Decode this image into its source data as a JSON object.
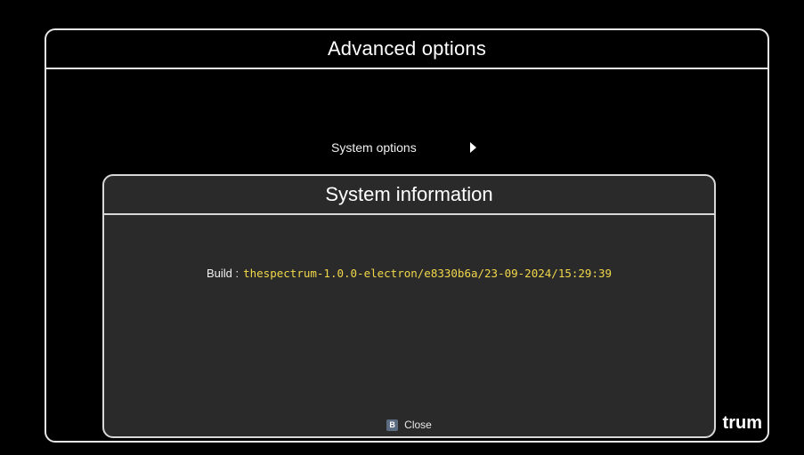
{
  "advanced_options": {
    "title": "Advanced options",
    "menu": {
      "system_options_label": "System options",
      "arrow_icon": "triangle-right-icon"
    },
    "brand_partial": "trum"
  },
  "system_information": {
    "title": "System information",
    "build_label": "Build :",
    "build_value": "thespectrum-1.0.0-electron/e8330b6a/23-09-2024/15:29:39",
    "footer": {
      "button_key": "B",
      "close_label": "Close"
    }
  },
  "colors": {
    "background": "#000000",
    "panel": "#2a2a2a",
    "border": "#e6e6e6",
    "build_value": "#f1d84a",
    "key_badge": "#5b6b82"
  }
}
